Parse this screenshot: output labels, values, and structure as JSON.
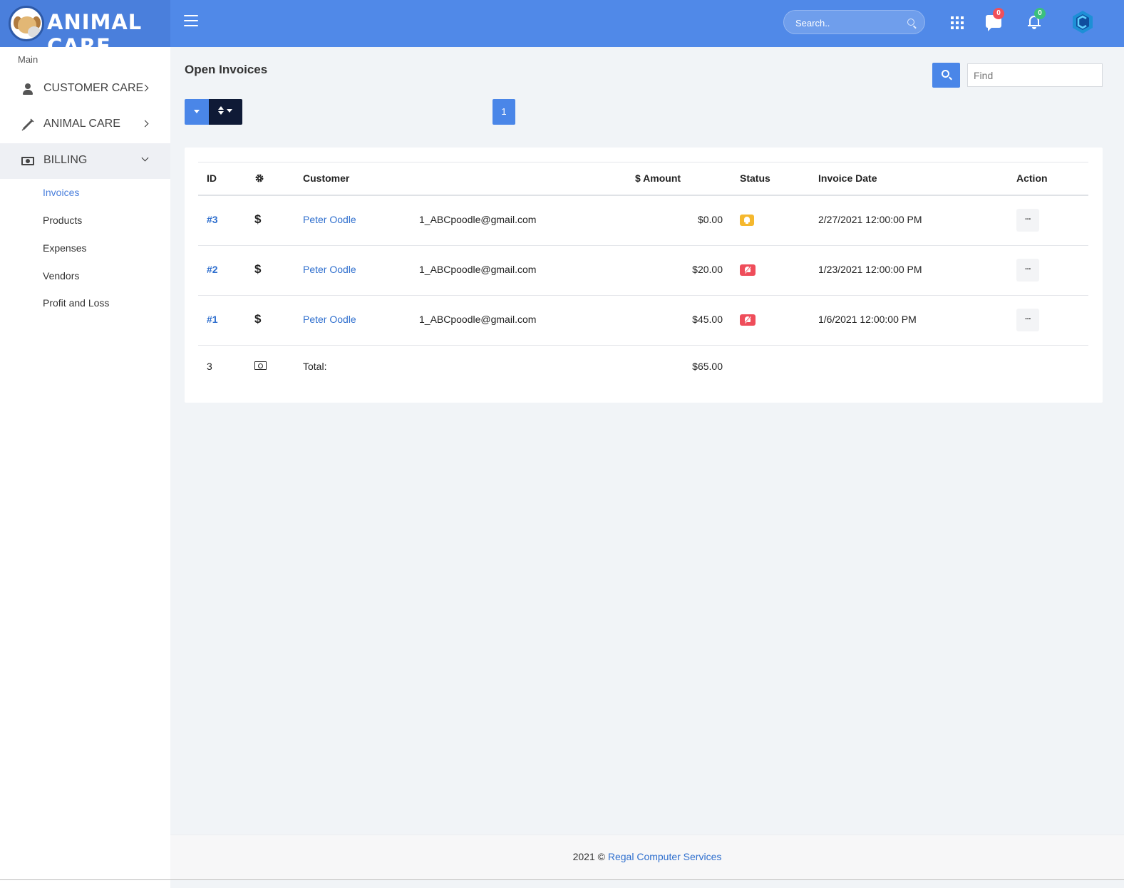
{
  "header": {
    "logo_text": "ANIMAL CARE",
    "search_placeholder": "Search..",
    "messages_count": "0",
    "notifications_count": "0"
  },
  "sidebar": {
    "section_label": "Main",
    "items": [
      {
        "label": "CUSTOMER CARE",
        "icon": "user-icon"
      },
      {
        "label": "ANIMAL CARE",
        "icon": "syringe-icon"
      },
      {
        "label": "BILLING",
        "icon": "money-bill-icon"
      }
    ],
    "billing_sub": [
      "Invoices",
      "Products",
      "Expenses",
      "Vendors",
      "Profit and Loss"
    ]
  },
  "main": {
    "title": "Open Invoices",
    "find_placeholder": "Find",
    "page_number": "1",
    "columns": [
      "ID",
      "Customer",
      "$ Amount",
      "Status",
      "Invoice Date",
      "Action"
    ],
    "rows": [
      {
        "id": "#3",
        "type": "$",
        "customer": "Peter Oodle",
        "email": "1_ABCpoodle@gmail.com",
        "amount": "$0.00",
        "status": "reminder",
        "date": "2/27/2021 12:00:00 PM"
      },
      {
        "id": "#2",
        "type": "$",
        "customer": "Peter Oodle",
        "email": "1_ABCpoodle@gmail.com",
        "amount": "$20.00",
        "status": "muted",
        "date": "1/23/2021 12:00:00 PM"
      },
      {
        "id": "#1",
        "type": "$",
        "customer": "Peter Oodle",
        "email": "1_ABCpoodle@gmail.com",
        "amount": "$45.00",
        "status": "muted",
        "date": "1/6/2021 12:00:00 PM"
      }
    ],
    "total": {
      "count": "3",
      "label": "Total:",
      "amount": "$65.00"
    },
    "action_label": "···"
  },
  "footer": {
    "prefix": "2021 © ",
    "company": "Regal Computer Services"
  },
  "colors": {
    "header_bg": "#5089e8",
    "accent": "#4a86e8",
    "status_reminder": "#f5b82e",
    "status_muted": "#ef4d5a"
  }
}
